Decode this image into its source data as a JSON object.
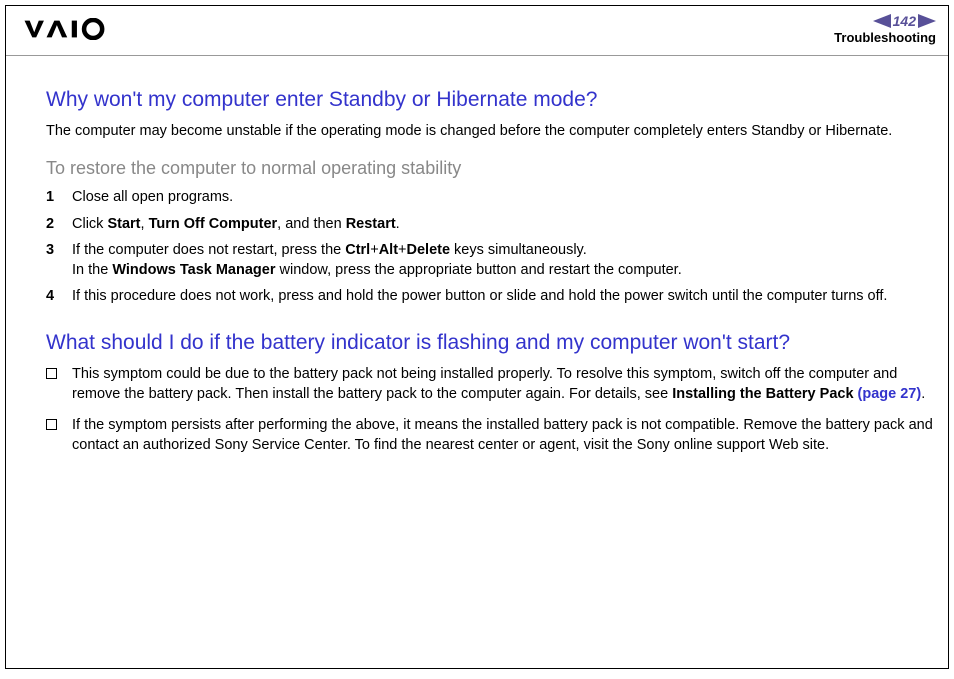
{
  "header": {
    "page_number": "142",
    "section": "Troubleshooting"
  },
  "q1": {
    "heading": "Why won't my computer enter Standby or Hibernate mode?",
    "intro": "The computer may become unstable if the operating mode is changed before the computer completely enters Standby or Hibernate.",
    "subheading": "To restore the computer to normal operating stability",
    "steps": {
      "s1": {
        "num": "1",
        "text": "Close all open programs."
      },
      "s2": {
        "num": "2",
        "pre": "Click ",
        "b1": "Start",
        "sep1": ", ",
        "b2": "Turn Off Computer",
        "sep2": ", and then ",
        "b3": "Restart",
        "post": "."
      },
      "s3": {
        "num": "3",
        "line1_pre": "If the computer does not restart, press the ",
        "b1": "Ctrl",
        "plus1": "+",
        "b2": "Alt",
        "plus2": "+",
        "b3": "Delete",
        "line1_post": " keys simultaneously.",
        "line2_pre": "In the ",
        "b4": "Windows Task Manager",
        "line2_post": " window, press the appropriate button and restart the computer."
      },
      "s4": {
        "num": "4",
        "text": "If this procedure does not work, press and hold the power button or slide and hold the power switch until the computer turns off."
      }
    }
  },
  "q2": {
    "heading": "What should I do if the battery indicator is flashing and my computer won't start?",
    "bullets": {
      "b1": {
        "pre": "This symptom could be due to the battery pack not being installed properly. To resolve this symptom, switch off the computer and remove the battery pack. Then install the battery pack to the computer again. For details, see ",
        "bold": "Installing the Battery Pack ",
        "link": "(page 27)",
        "post": "."
      },
      "b2": {
        "text": "If the symptom persists after performing the above, it means the installed battery pack is not compatible. Remove the battery pack and contact an authorized Sony Service Center. To find the nearest center or agent, visit the Sony online support Web site."
      }
    }
  }
}
